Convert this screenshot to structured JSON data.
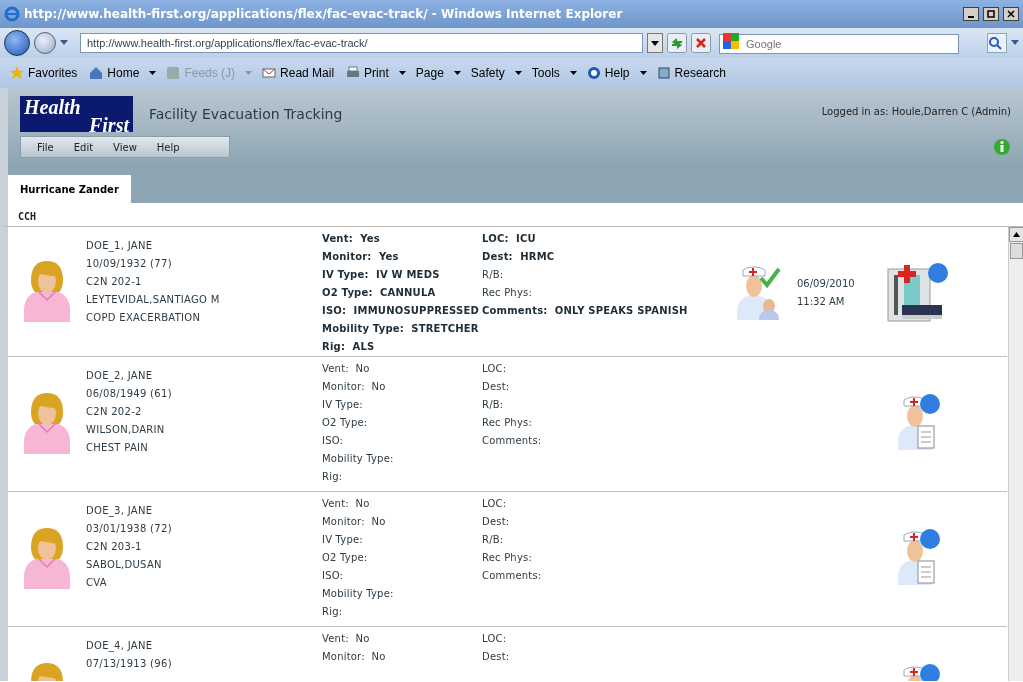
{
  "browser": {
    "title": "http://www.health-first.org/applications/flex/fac-evac-track/ - Windows Internet Explorer",
    "address": "http://www.health-first.org/applications/flex/fac-evac-track/",
    "search_placeholder": "Google",
    "commands": [
      {
        "label": "Favorites",
        "disabled": false,
        "has_menu": false
      },
      {
        "label": "Home",
        "disabled": false,
        "has_menu": true
      },
      {
        "label": "Feeds (J)",
        "disabled": true,
        "has_menu": true
      },
      {
        "label": "Read Mail",
        "disabled": false,
        "has_menu": false
      },
      {
        "label": "Print",
        "disabled": false,
        "has_menu": true
      },
      {
        "label": "Page",
        "disabled": false,
        "has_menu": true
      },
      {
        "label": "Safety",
        "disabled": false,
        "has_menu": true
      },
      {
        "label": "Tools",
        "disabled": false,
        "has_menu": true
      },
      {
        "label": "Help",
        "disabled": false,
        "has_menu": true
      },
      {
        "label": "Research",
        "disabled": false,
        "has_menu": false
      }
    ]
  },
  "app": {
    "logo": [
      "Health",
      "First"
    ],
    "title": "Facility Evacuation Tracking",
    "logged_in": "Logged in as: Houle,Darren C (Admin)",
    "menu": [
      "File",
      "Edit",
      "View",
      "Help"
    ],
    "tabs": [
      {
        "label": "Hurricane Zander",
        "selected": true
      }
    ],
    "section": "CCH",
    "patients": [
      {
        "kind": "tracked",
        "name": "DOE_1, JANE",
        "dob": "10/09/1932 (77)",
        "room": "C2N 202-1",
        "physician": "LEYTEVIDAL,SANTIAGO M",
        "diagnosis": "COPD EXACERBATION",
        "date": "06/09/2010",
        "time": "11:32 AM",
        "fields_left": [
          {
            "label": "Vent:",
            "value": "Yes",
            "emphasized": true
          },
          {
            "label": "Monitor:",
            "value": "Yes",
            "emphasized": true
          },
          {
            "label": "IV Type:",
            "value": "IV W MEDS",
            "emphasized": true
          },
          {
            "label": "O2 Type:",
            "value": "CANNULA",
            "emphasized": true
          },
          {
            "label": "ISO:",
            "value": "IMMUNOSUPPRESSED",
            "emphasized": true
          },
          {
            "label": "Mobility Type:",
            "value": "STRETCHER",
            "emphasized": true
          },
          {
            "label": "Rig:",
            "value": "ALS",
            "emphasized": true
          }
        ],
        "fields_right": [
          {
            "label": "LOC:",
            "value": "ICU",
            "emphasized": true
          },
          {
            "label": "Dest:",
            "value": "HRMC",
            "emphasized": true
          },
          {
            "label": "R/B:",
            "emphasized": false
          },
          {
            "label": "Rec Phys:",
            "emphasized": false
          },
          {
            "label": "Comments:",
            "value": "ONLY SPEAKS SPANISH",
            "emphasized": true
          }
        ]
      },
      {
        "kind": "pending",
        "name": "DOE_2, JANE",
        "dob": "06/08/1949 (61)",
        "room": "C2N 202-2",
        "physician": "WILSON,DARIN",
        "diagnosis": "CHEST PAIN",
        "fields_left": [
          {
            "label": "Vent:",
            "value": "No",
            "emphasized": false
          },
          {
            "label": "Monitor:",
            "value": "No",
            "emphasized": false
          },
          {
            "label": "IV Type:",
            "emphasized": false
          },
          {
            "label": "O2 Type:",
            "emphasized": false
          },
          {
            "label": "ISO:",
            "emphasized": false
          },
          {
            "label": "Mobility Type:",
            "emphasized": false
          },
          {
            "label": "Rig:",
            "emphasized": false
          }
        ],
        "fields_right": [
          {
            "label": "LOC:",
            "emphasized": false
          },
          {
            "label": "Dest:",
            "emphasized": false
          },
          {
            "label": "R/B:",
            "emphasized": false
          },
          {
            "label": "Rec Phys:",
            "emphasized": false
          },
          {
            "label": "Comments:",
            "emphasized": false
          }
        ]
      },
      {
        "kind": "pending",
        "name": "DOE_3, JANE",
        "dob": "03/01/1938 (72)",
        "room": "C2N 203-1",
        "physician": "SABOL,DUSAN",
        "diagnosis": "CVA",
        "fields_left": [
          {
            "label": "Vent:",
            "value": "No",
            "emphasized": false
          },
          {
            "label": "Monitor:",
            "value": "No",
            "emphasized": false
          },
          {
            "label": "IV Type:",
            "emphasized": false
          },
          {
            "label": "O2 Type:",
            "emphasized": false
          },
          {
            "label": "ISO:",
            "emphasized": false
          },
          {
            "label": "Mobility Type:",
            "emphasized": false
          },
          {
            "label": "Rig:",
            "emphasized": false
          }
        ],
        "fields_right": [
          {
            "label": "LOC:",
            "emphasized": false
          },
          {
            "label": "Dest:",
            "emphasized": false
          },
          {
            "label": "R/B:",
            "emphasized": false
          },
          {
            "label": "Rec Phys:",
            "emphasized": false
          },
          {
            "label": "Comments:",
            "emphasized": false
          }
        ]
      },
      {
        "kind": "pending",
        "name": "DOE_4, JANE",
        "dob": "07/13/1913 (96)",
        "fields_left": [
          {
            "label": "Vent:",
            "value": "No",
            "emphasized": false
          },
          {
            "label": "Monitor:",
            "value": "No",
            "emphasized": false
          }
        ],
        "fields_right": [
          {
            "label": "LOC:",
            "emphasized": false
          },
          {
            "label": "Dest:",
            "emphasized": false
          }
        ]
      }
    ]
  }
}
